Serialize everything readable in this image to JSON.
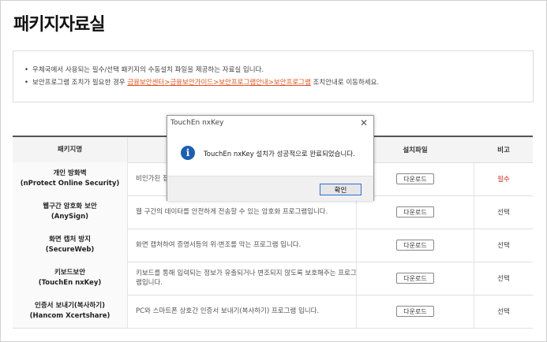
{
  "page": {
    "title": "패키지자료실"
  },
  "notice": {
    "line1": "우체국에서 사용되는 필수/선택 패키지의 수동설치 파일을 제공하는 자료실 입니다.",
    "line2_prefix": "보안프로그램 조치가 필요한 경우 ",
    "line2_link": "금융보안센터>금융보안가이드>보안프로그램안내>보안프로그램",
    "line2_suffix": " 조치안내로 이동하세요."
  },
  "table": {
    "headers": [
      "패키지명",
      "",
      "설치파일",
      "비고"
    ],
    "rows": [
      {
        "name_line1": "개인 방화벽",
        "name_line2": "(nProtect Online Security)",
        "desc": "비인가된 접근으로부터 PC를 보호하는 개인방화벽 프로그램입니다.",
        "file": "다운로드",
        "note": "필수",
        "required": true
      },
      {
        "name_line1": "웹구간 암호화 보안",
        "name_line2": "(AnySign)",
        "desc": "웹 구간의 데이터를 안전하게 전송할 수 있는 암호화 프로그램입니다.",
        "file": "다운로드",
        "note": "선택",
        "required": false
      },
      {
        "name_line1": "화면 캡처 방지",
        "name_line2": "(SecureWeb)",
        "desc": "화면 캡처하여 증명서등의 위·변조를 막는 프로그램 입니다.",
        "file": "다운로드",
        "note": "선택",
        "required": false
      },
      {
        "name_line1": "키보드보안",
        "name_line2": "(TouchEn nxKey)",
        "desc": "키보드를 통해 입력되는 정보가 유출되거나 변조되지 않도록 보호해주는 프로그램입니다.",
        "file": "다운로드",
        "note": "선택",
        "required": false
      },
      {
        "name_line1": "인증서 보내기(복사하기)",
        "name_line2": "(Hancom Xcertshare)",
        "desc": "PC와 스마트폰 상호간 인증서 보내기(복사하기) 프로그램 입니다.",
        "file": "다운로드",
        "note": "선택",
        "required": false
      }
    ]
  },
  "dialog": {
    "title": "TouchEn nxKey",
    "close_symbol": "✕",
    "icon": "info-icon",
    "icon_glyph": "i",
    "message": "TouchEn nxKey 설치가 성공적으로 완료되었습니다.",
    "ok_label": "확인"
  },
  "colors": {
    "accent_link": "#e0531f",
    "required": "#d7261c",
    "info_icon": "#1a5fb4",
    "ok_border": "#2a6fd6"
  }
}
